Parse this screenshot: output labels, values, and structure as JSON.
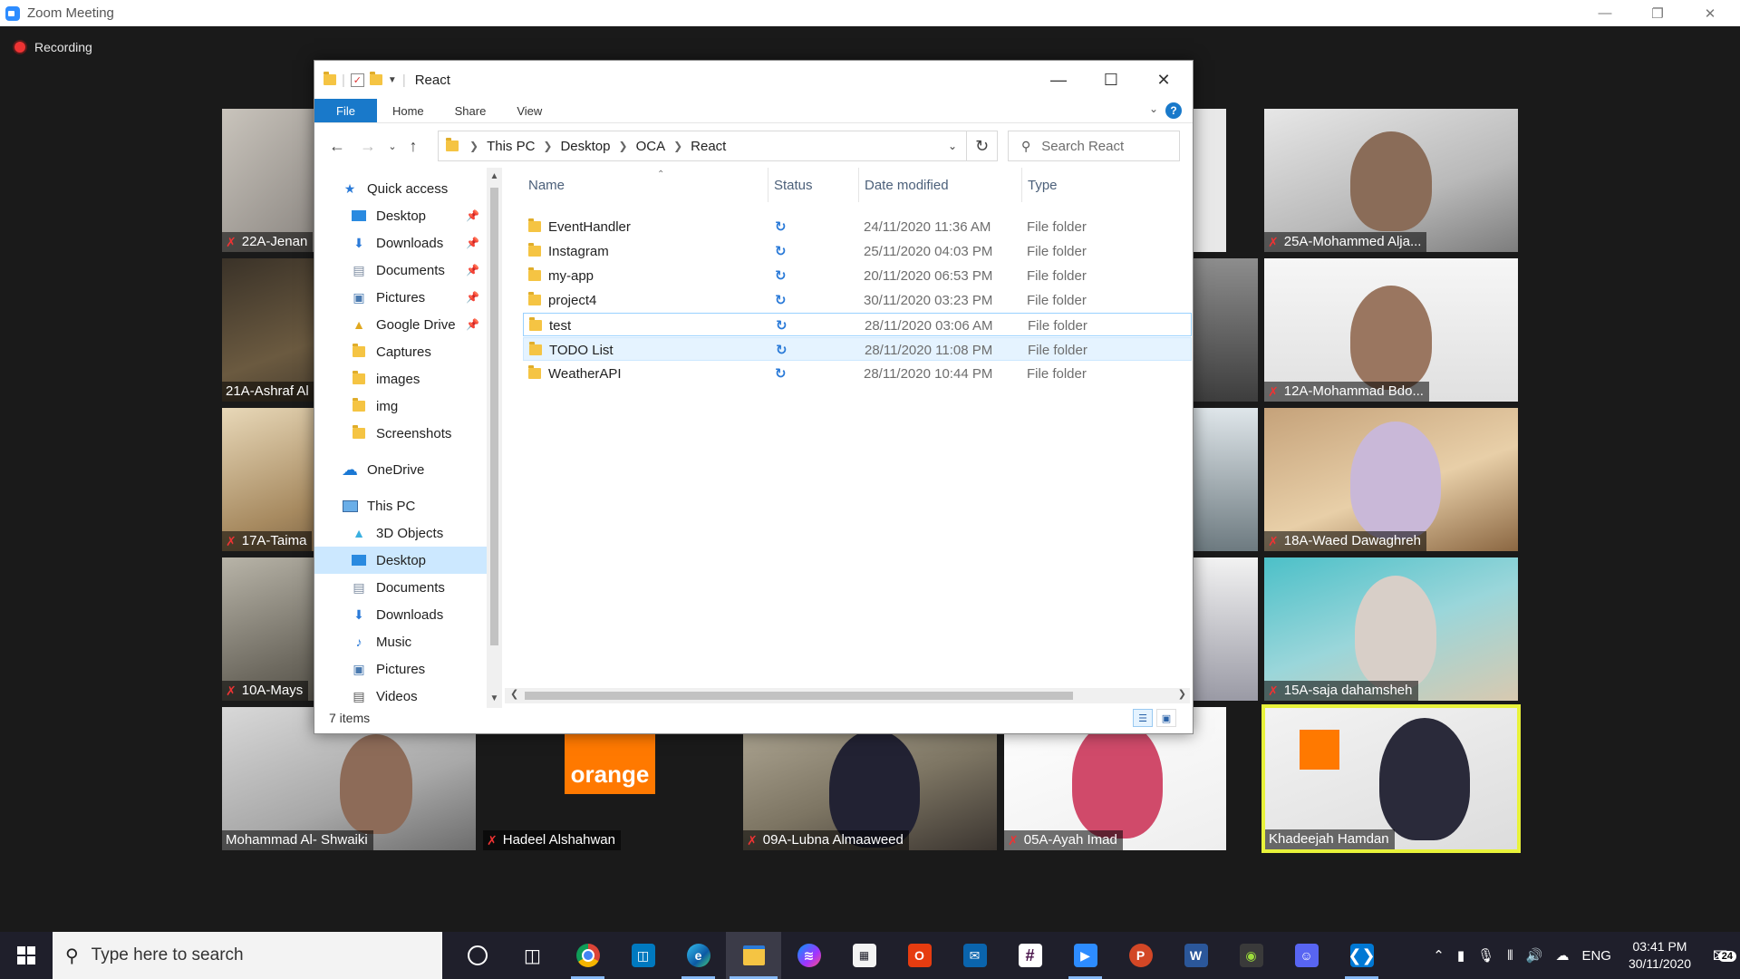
{
  "zoom": {
    "window_title": "Zoom Meeting",
    "recording_label": "Recording",
    "participants": [
      {
        "name": "22A-Jenan"
      },
      {
        "name": "21A-Ashraf Al"
      },
      {
        "name": "17A-Taima"
      },
      {
        "name": "10A-Mays"
      },
      {
        "name": "25A-Mohammed Alja..."
      },
      {
        "name": "12A-Mohammad Bdo..."
      },
      {
        "name": "18A-Waed Dawaghreh"
      },
      {
        "name": "15A-saja dahamsheh"
      },
      {
        "name": "Mohammad Al- Shwaiki"
      },
      {
        "name": "Hadeel Alshahwan"
      },
      {
        "name": "09A-Lubna Almaaweed"
      },
      {
        "name": "05A-Ayah Imad"
      },
      {
        "name": "Khadeejah Hamdan"
      }
    ],
    "brand_logo_text": "orange"
  },
  "explorer": {
    "title": "React",
    "ribbon_tabs": [
      "File",
      "Home",
      "Share",
      "View"
    ],
    "help_label": "?",
    "breadcrumb": [
      "This PC",
      "Desktop",
      "OCA",
      "React"
    ],
    "search_placeholder": "Search React",
    "nav": {
      "quick_access": "Quick access",
      "quick_items": [
        "Desktop",
        "Downloads",
        "Documents",
        "Pictures",
        "Google Drive",
        "Captures",
        "images",
        "img",
        "Screenshots"
      ],
      "onedrive": "OneDrive",
      "this_pc": "This PC",
      "pc_items": [
        "3D Objects",
        "Desktop",
        "Documents",
        "Downloads",
        "Music",
        "Pictures",
        "Videos"
      ]
    },
    "columns": {
      "name": "Name",
      "status": "Status",
      "date": "Date modified",
      "type": "Type"
    },
    "files": [
      {
        "name": "EventHandler",
        "date": "24/11/2020 11:36 AM",
        "type": "File folder"
      },
      {
        "name": "Instagram",
        "date": "25/11/2020 04:03 PM",
        "type": "File folder"
      },
      {
        "name": "my-app",
        "date": "20/11/2020 06:53 PM",
        "type": "File folder"
      },
      {
        "name": "project4",
        "date": "30/11/2020 03:23 PM",
        "type": "File folder"
      },
      {
        "name": "test",
        "date": "28/11/2020 03:06 AM",
        "type": "File folder"
      },
      {
        "name": "TODO List",
        "date": "28/11/2020 11:08 PM",
        "type": "File folder"
      },
      {
        "name": "WeatherAPI",
        "date": "28/11/2020 10:44 PM",
        "type": "File folder"
      }
    ],
    "item_count": "7 items"
  },
  "taskbar": {
    "search_placeholder": "Type here to search",
    "language": "ENG",
    "time": "03:41 PM",
    "date": "30/11/2020",
    "notification_count": "24"
  },
  "colors": {
    "zoom_bg": "#1a1a1a",
    "accent_blue": "#1979ca",
    "active_speaker": "#e8f23a",
    "taskbar": "#1f1f2b",
    "orange_brand": "#ff7900"
  }
}
